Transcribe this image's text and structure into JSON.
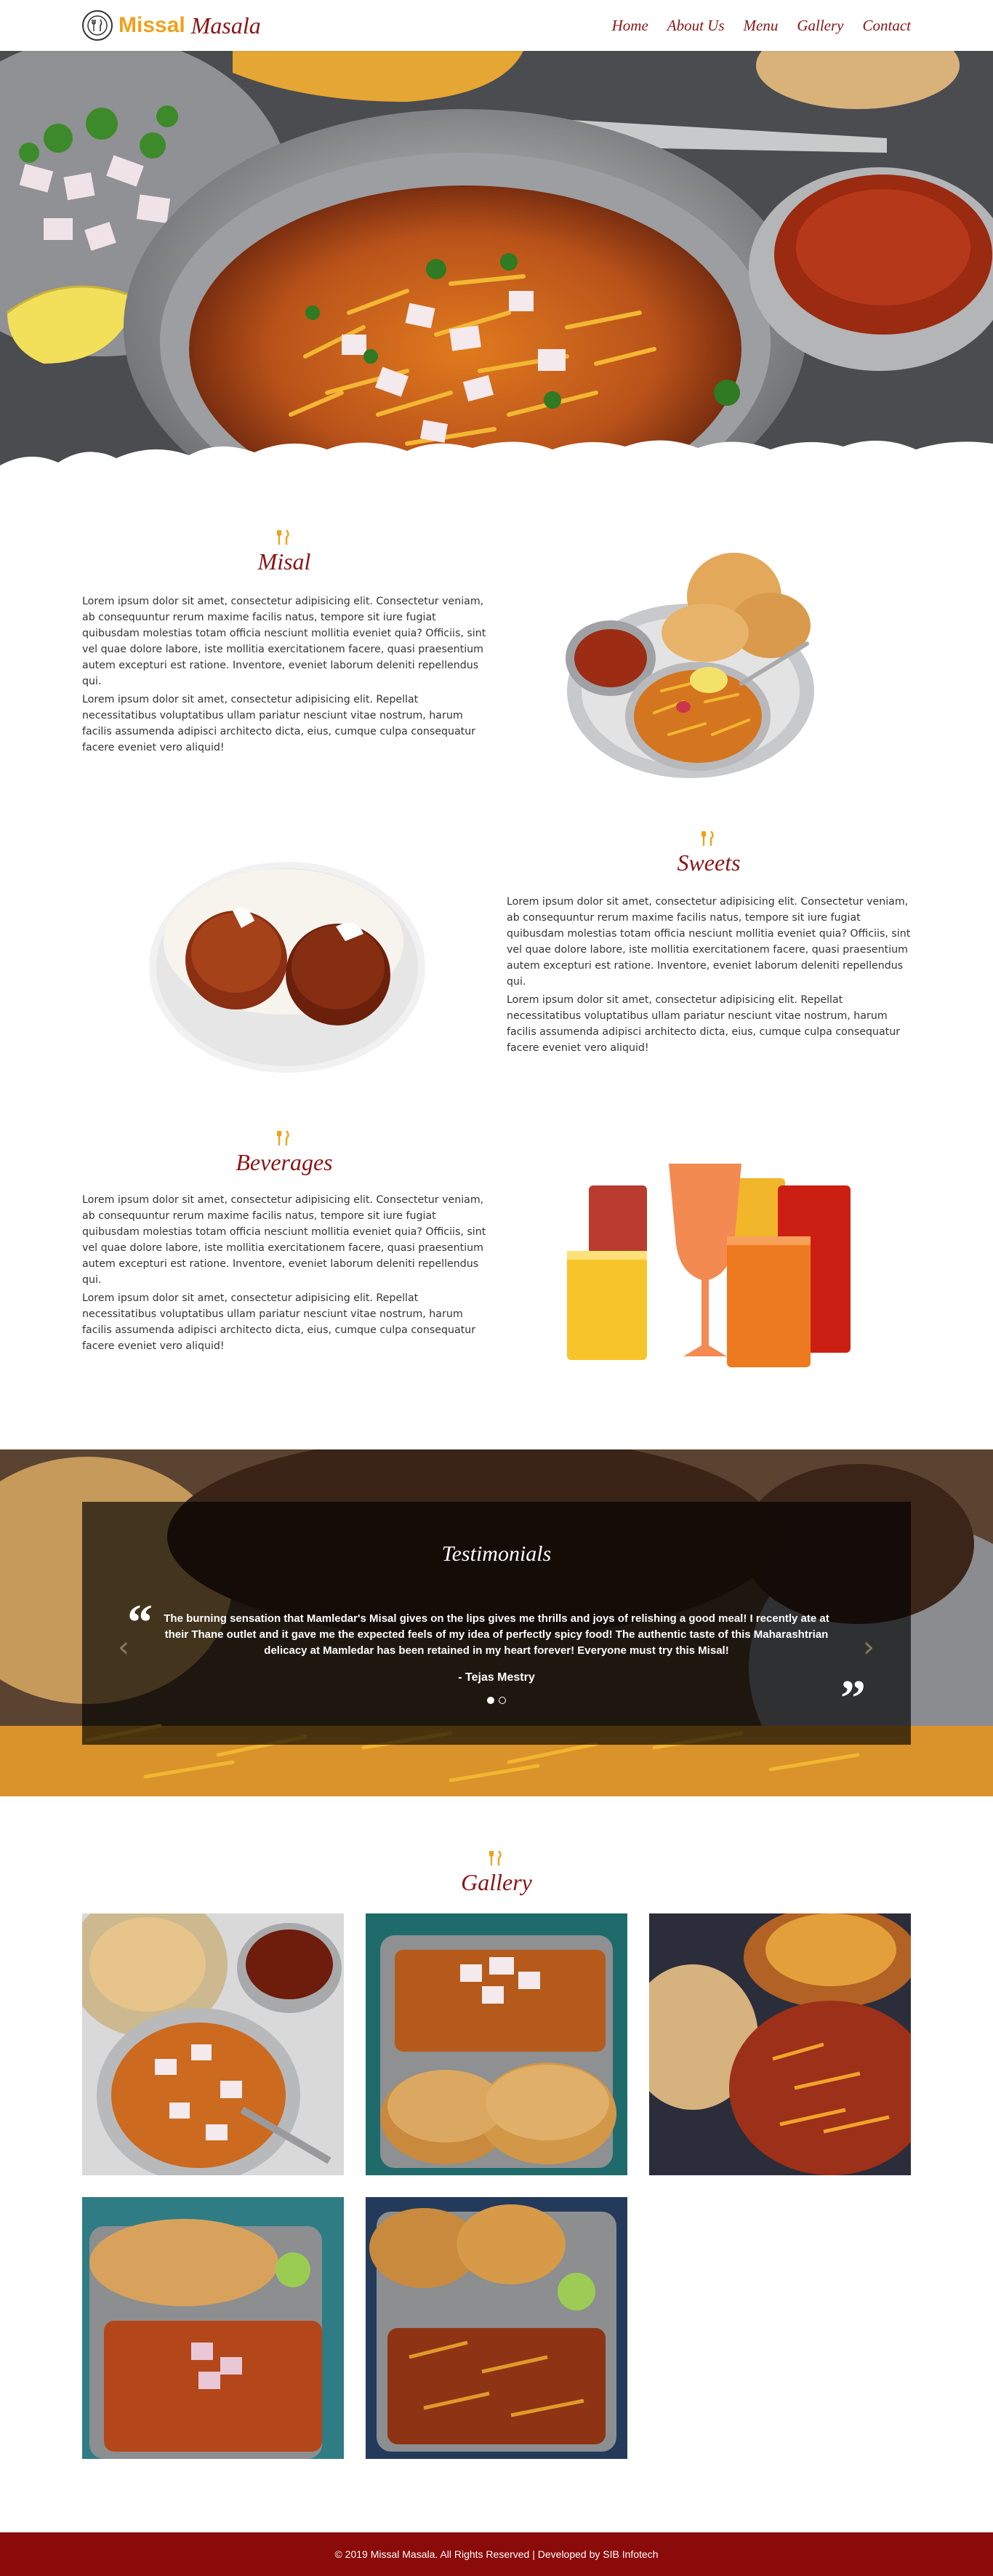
{
  "header": {
    "logo_word1": "Missal",
    "logo_word2": "Masala",
    "nav": [
      "Home",
      "About Us",
      "Menu",
      "Gallery",
      "Contact"
    ]
  },
  "hero": {
    "image": "misal-pav-plate-icon"
  },
  "sections": [
    {
      "title": "Misal",
      "para1": "Lorem ipsum dolor sit amet, consectetur adipisicing elit. Consectetur veniam, ab consequuntur rerum maxime facilis natus, tempore sit iure fugiat quibusdam molestias totam officia nesciunt mollitia eveniet quia? Officiis, sint vel quae dolore labore, iste mollitia exercitationem facere, quasi praesentium autem excepturi est ratione. Inventore, eveniet laborum deleniti repellendus qui.",
      "para2": "Lorem ipsum dolor sit amet, consectetur adipisicing elit. Repellat necessitatibus voluptatibus ullam pariatur nesciunt vitae nostrum, harum facilis assumenda adipisci architecto dicta, eius, cumque culpa consequatur facere eveniet vero aliquid!"
    },
    {
      "title": "Sweets",
      "para1": "Lorem ipsum dolor sit amet, consectetur adipisicing elit. Consectetur veniam, ab consequuntur rerum maxime facilis natus, tempore sit iure fugiat quibusdam molestias totam officia nesciunt mollitia eveniet quia? Officiis, sint vel quae dolore labore, iste mollitia exercitationem facere, quasi praesentium autem excepturi est ratione. Inventore, eveniet laborum deleniti repellendus qui.",
      "para2": "Lorem ipsum dolor sit amet, consectetur adipisicing elit. Repellat necessitatibus voluptatibus ullam pariatur nesciunt vitae nostrum, harum facilis assumenda adipisci architecto dicta, eius, cumque culpa consequatur facere eveniet vero aliquid!"
    },
    {
      "title": "Beverages",
      "para1": "Lorem ipsum dolor sit amet, consectetur adipisicing elit. Consectetur veniam, ab consequuntur rerum maxime facilis natus, tempore sit iure fugiat quibusdam molestias totam officia nesciunt mollitia eveniet quia? Officiis, sint vel quae dolore labore, iste mollitia exercitationem facere, quasi praesentium autem excepturi est ratione. Inventore, eveniet laborum deleniti repellendus qui.",
      "para2": "Lorem ipsum dolor sit amet, consectetur adipisicing elit. Repellat necessitatibus voluptatibus ullam pariatur nesciunt vitae nostrum, harum facilis assumenda adipisci architecto dicta, eius, cumque culpa consequatur facere eveniet vero aliquid!"
    }
  ],
  "testimonials": {
    "title": "Testimonials",
    "quote": "The burning sensation that Mamledar's Misal gives on the lips gives me thrills and joys of relishing a good meal! I recently ate at their Thane outlet and it gave me the expected feels of my idea of perfectly spicy food! The authentic taste of this Maharashtrian delicacy at Mamledar has been retained in my heart forever! Everyone must try this Misal!",
    "author": "- Tejas Mestry",
    "slide_count": 2,
    "active_slide": 1
  },
  "gallery": {
    "title": "Gallery",
    "images": [
      "gallery-misal-pav-1",
      "gallery-misal-pav-2",
      "gallery-misal-pav-3",
      "gallery-misal-pav-4",
      "gallery-misal-pav-5"
    ]
  },
  "footer": {
    "text": "© 2019 Missal Masala. All Rights Reserved | Developed by SIB Infotech"
  },
  "colors": {
    "brand_red": "#8b1414",
    "brand_orange": "#f0a11a",
    "footer_bg": "#8b0a0a"
  }
}
